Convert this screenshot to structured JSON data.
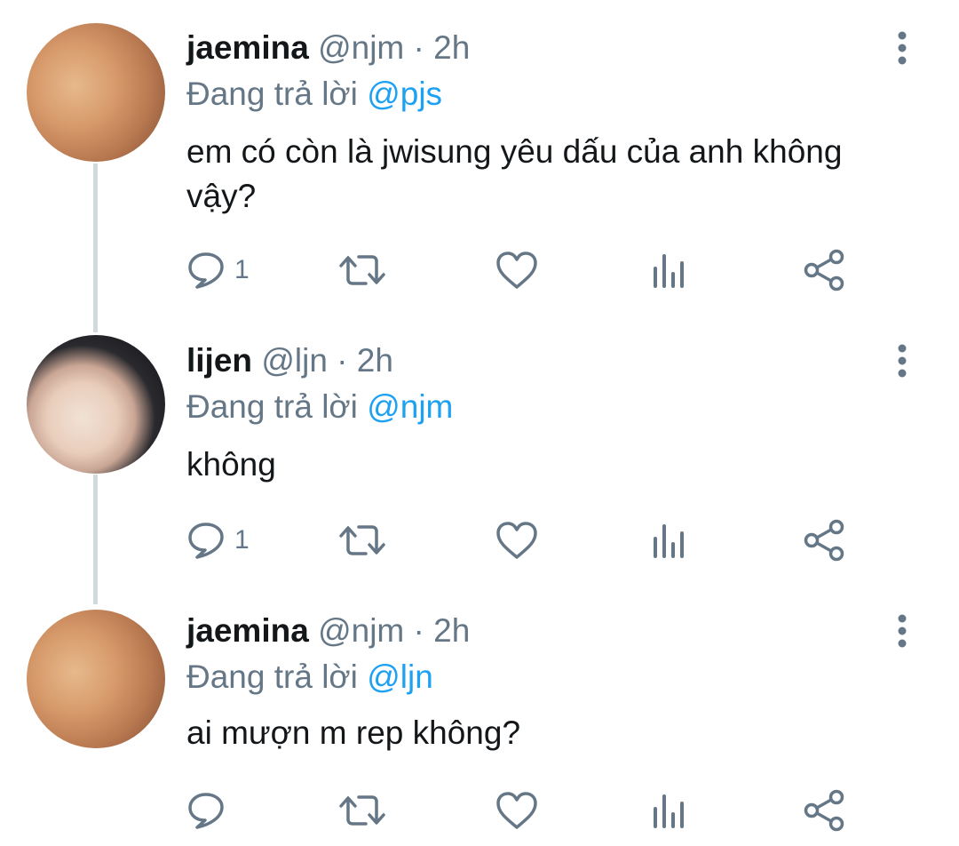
{
  "thread": {
    "tweets": [
      {
        "name": "jaemina",
        "handle": "@njm",
        "separator": "·",
        "time": "2h",
        "reply_prefix": "Đang trả lời",
        "reply_to": "@pjs",
        "text": "em có còn là jwisung yêu dấu của anh không vậy?",
        "reply_count": "1",
        "avatar_icon": "profile-photo-warm"
      },
      {
        "name": "lijen",
        "handle": "@ljn",
        "separator": "·",
        "time": "2h",
        "reply_prefix": "Đang trả lời",
        "reply_to": "@njm",
        "text": "không",
        "reply_count": "1",
        "avatar_icon": "profile-photo-dark-hair"
      },
      {
        "name": "jaemina",
        "handle": "@njm",
        "separator": "·",
        "time": "2h",
        "reply_prefix": "Đang trả lời",
        "reply_to": "@ljn",
        "text": "ai mượn m rep không?",
        "reply_count": "",
        "avatar_icon": "profile-photo-warm"
      }
    ]
  },
  "colors": {
    "text": "#14171a",
    "secondary": "#657786",
    "mention": "#1da1f2",
    "icon": "#657786",
    "thread_line": "#cfd9de"
  },
  "icons": {
    "reply": "reply-icon",
    "retweet": "retweet-icon",
    "like": "like-icon",
    "stats": "analytics-icon",
    "share": "share-icon",
    "more": "more-vertical-icon"
  }
}
